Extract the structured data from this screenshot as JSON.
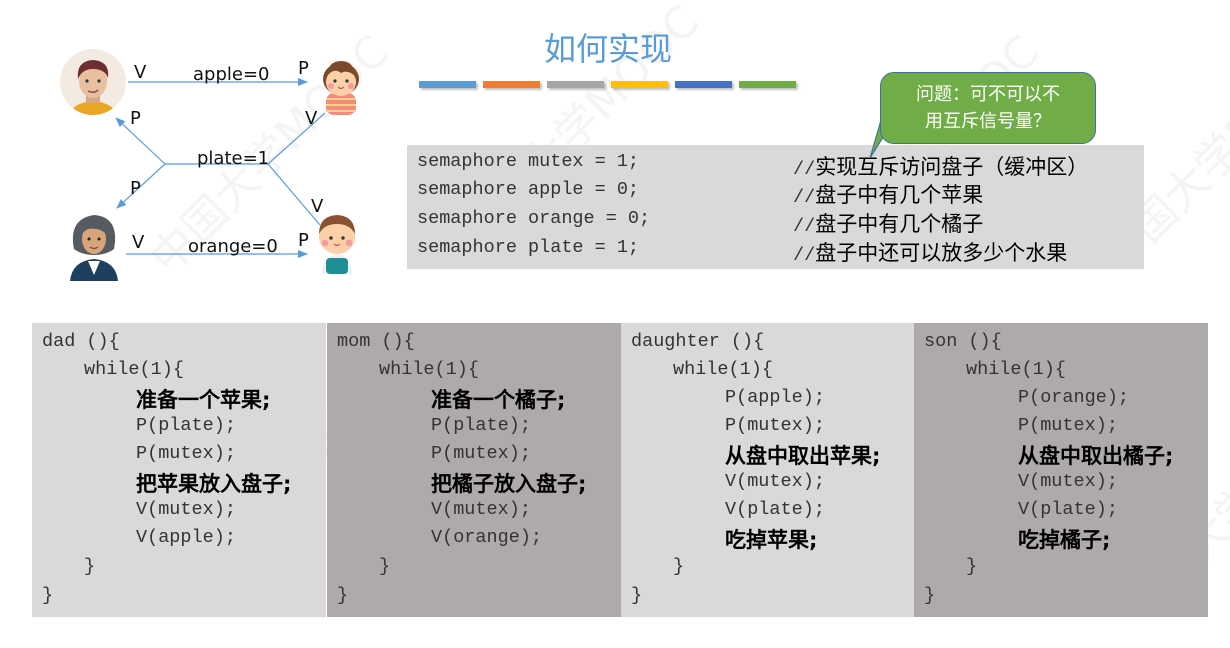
{
  "title": "如何实现",
  "color_bars": [
    "#5b9bd5",
    "#ed7d31",
    "#a5a5a5",
    "#ffc000",
    "#4472c4",
    "#70ad47"
  ],
  "watermark": "中国大学MOOC",
  "diagram": {
    "nodes": [
      {
        "id": "dad",
        "name": "dad-avatar"
      },
      {
        "id": "daughter",
        "name": "daughter-avatar"
      },
      {
        "id": "mom",
        "name": "mom-avatar"
      },
      {
        "id": "son",
        "name": "son-avatar"
      }
    ],
    "labels": {
      "apple": "apple=0",
      "plate": "plate=1",
      "orange": "orange=0",
      "dad_v": "V",
      "daughter_p": "P",
      "dad_p": "P",
      "daughter_v": "V",
      "mom_p": "P",
      "son_v": "V",
      "mom_v": "V",
      "son_p": "P"
    }
  },
  "bubble": {
    "line1": "问题：可不可以不",
    "line2": "用互斥信号量？"
  },
  "semaphores": [
    {
      "code": "semaphore mutex = 1;",
      "slash": "//",
      "comment": "实现互斥访问盘子（缓冲区）"
    },
    {
      "code": "semaphore apple = 0;",
      "slash": "//",
      "comment": "盘子中有几个苹果"
    },
    {
      "code": "semaphore orange = 0;",
      "slash": "//",
      "comment": "盘子中有几个橘子"
    },
    {
      "code": "semaphore plate = 1;",
      "slash": "//",
      "comment": "盘子中还可以放多少个水果"
    }
  ],
  "processes": [
    {
      "name": "dad",
      "header": "dad (){",
      "loop": "while(1){",
      "body": [
        {
          "text": "准备一个苹果;",
          "type": "cn"
        },
        {
          "text": "P(plate);",
          "type": "code"
        },
        {
          "text": "P(mutex);",
          "type": "code"
        },
        {
          "text": "把苹果放入盘子;",
          "type": "cn"
        },
        {
          "text": "V(mutex);",
          "type": "code"
        },
        {
          "text": "V(apple);",
          "type": "code"
        }
      ],
      "close_inner": "}",
      "close_outer": "}"
    },
    {
      "name": "mom",
      "header": "mom (){",
      "loop": "while(1){",
      "body": [
        {
          "text": "准备一个橘子;",
          "type": "cn"
        },
        {
          "text": "P(plate);",
          "type": "code"
        },
        {
          "text": "P(mutex);",
          "type": "code"
        },
        {
          "text": "把橘子放入盘子;",
          "type": "cn"
        },
        {
          "text": "V(mutex);",
          "type": "code"
        },
        {
          "text": "V(orange);",
          "type": "code"
        }
      ],
      "close_inner": "}",
      "close_outer": "}"
    },
    {
      "name": "daughter",
      "header": "daughter (){",
      "loop": "while(1){",
      "body": [
        {
          "text": "P(apple);",
          "type": "code"
        },
        {
          "text": "P(mutex);",
          "type": "code"
        },
        {
          "text": "从盘中取出苹果;",
          "type": "cn"
        },
        {
          "text": "V(mutex);",
          "type": "code"
        },
        {
          "text": "V(plate);",
          "type": "code"
        },
        {
          "text": "吃掉苹果;",
          "type": "cn"
        }
      ],
      "close_inner": "}",
      "close_outer": "}"
    },
    {
      "name": "son",
      "header": "son (){",
      "loop": "while(1){",
      "body": [
        {
          "text": "P(orange);",
          "type": "code"
        },
        {
          "text": "P(mutex);",
          "type": "code"
        },
        {
          "text": "从盘中取出橘子;",
          "type": "cn"
        },
        {
          "text": "V(mutex);",
          "type": "code"
        },
        {
          "text": "V(plate);",
          "type": "code"
        },
        {
          "text": "吃掉橘子;",
          "type": "cn"
        }
      ],
      "close_inner": "}",
      "close_outer": "}"
    }
  ]
}
